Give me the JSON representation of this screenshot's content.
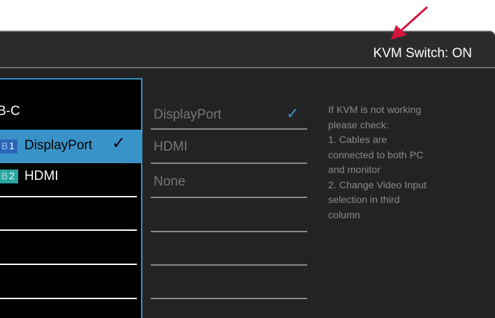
{
  "header": {
    "status": "KVM Switch: ON"
  },
  "left_column": {
    "items": [
      {
        "label": "B-C"
      },
      {
        "badge_prefix": "B",
        "badge_number": "1",
        "label": "DisplayPort",
        "checked": true
      },
      {
        "badge_prefix": "B",
        "badge_number": "2",
        "label": "HDMI"
      }
    ]
  },
  "middle_column": {
    "items": [
      {
        "label": "DisplayPort",
        "checked": true
      },
      {
        "label": "HDMI"
      },
      {
        "label": "None"
      }
    ]
  },
  "info_text": "If KVM is not working\nplease check:\n1. Cables are\nconnected to both PC\nand monitor\n2. Change Video Input\nselection in third\ncolumn",
  "icons": {
    "check": "checkmark-icon",
    "annotation": "arrow-icon"
  },
  "colors": {
    "accent": "#3a93c8",
    "annotation_arrow": "#d4143c",
    "badge1": "#2a66b8",
    "badge2": "#2aa7a4"
  }
}
